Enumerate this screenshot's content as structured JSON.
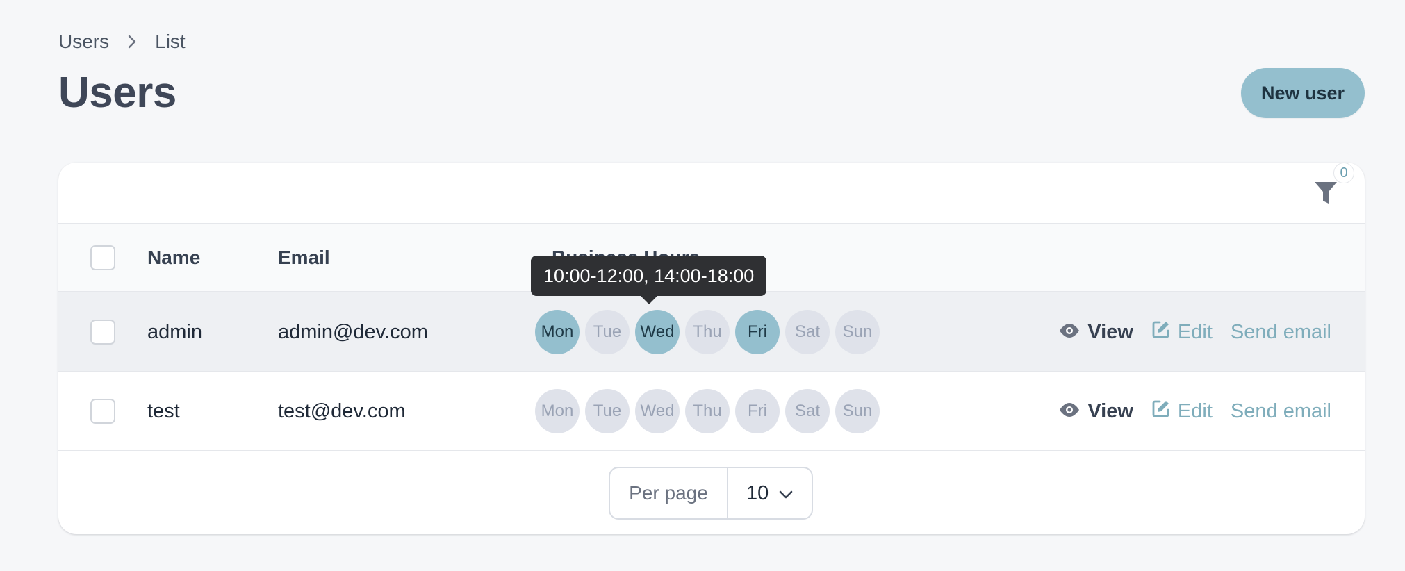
{
  "breadcrumb": {
    "items": [
      "Users",
      "List"
    ]
  },
  "page": {
    "title": "Users",
    "new_button_label": "New user"
  },
  "filter": {
    "count": "0"
  },
  "table": {
    "columns": {
      "name": "Name",
      "email": "Email",
      "hours": "Business Hours"
    },
    "rows": [
      {
        "name": "admin",
        "email": "admin@dev.com",
        "days": [
          {
            "label": "Mon",
            "active": true
          },
          {
            "label": "Tue",
            "active": false
          },
          {
            "label": "Wed",
            "active": true
          },
          {
            "label": "Thu",
            "active": false
          },
          {
            "label": "Fri",
            "active": true
          },
          {
            "label": "Sat",
            "active": false
          },
          {
            "label": "Sun",
            "active": false
          }
        ]
      },
      {
        "name": "test",
        "email": "test@dev.com",
        "days": [
          {
            "label": "Mon",
            "active": false
          },
          {
            "label": "Tue",
            "active": false
          },
          {
            "label": "Wed",
            "active": false
          },
          {
            "label": "Thu",
            "active": false
          },
          {
            "label": "Fri",
            "active": false
          },
          {
            "label": "Sat",
            "active": false
          },
          {
            "label": "Sun",
            "active": false
          }
        ]
      }
    ],
    "actions": {
      "view": "View",
      "edit": "Edit",
      "email": "Send email"
    }
  },
  "tooltip": {
    "text": "10:00-12:00, 14:00-18:00"
  },
  "pagination": {
    "per_page_label": "Per page",
    "per_page_value": "10"
  },
  "colors": {
    "accent": "#94bfce",
    "accent_text": "#7fadbb",
    "day_inactive": "#dfe2ea"
  }
}
